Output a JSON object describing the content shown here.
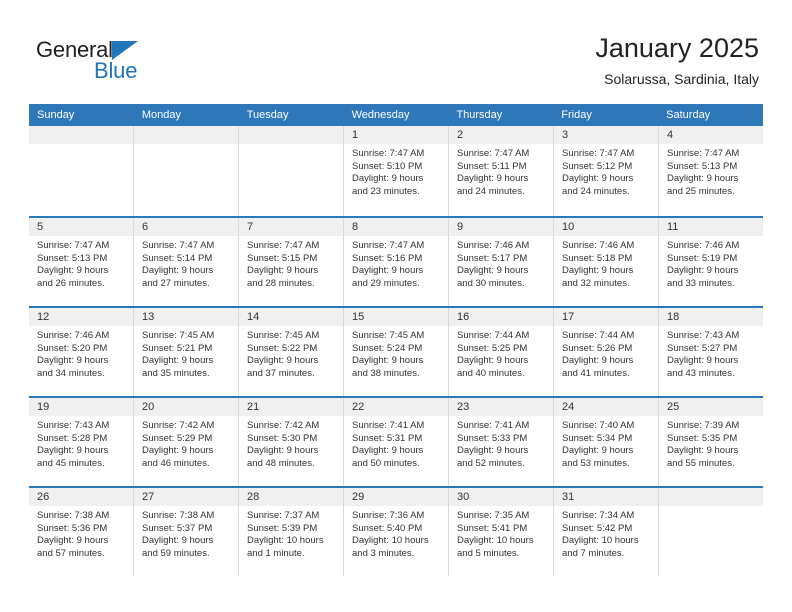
{
  "brand": {
    "name_dark": "General",
    "name_blue": "Blue",
    "accent_color": "#2e77b8"
  },
  "header": {
    "title": "January 2025",
    "subtitle": "Solarussa, Sardinia, Italy"
  },
  "calendar": {
    "day_headers": [
      "Sunday",
      "Monday",
      "Tuesday",
      "Wednesday",
      "Thursday",
      "Friday",
      "Saturday"
    ],
    "weeks": [
      [
        {
          "day": "",
          "lines": []
        },
        {
          "day": "",
          "lines": []
        },
        {
          "day": "",
          "lines": []
        },
        {
          "day": "1",
          "lines": [
            "Sunrise: 7:47 AM",
            "Sunset: 5:10 PM",
            "Daylight: 9 hours",
            "and 23 minutes."
          ]
        },
        {
          "day": "2",
          "lines": [
            "Sunrise: 7:47 AM",
            "Sunset: 5:11 PM",
            "Daylight: 9 hours",
            "and 24 minutes."
          ]
        },
        {
          "day": "3",
          "lines": [
            "Sunrise: 7:47 AM",
            "Sunset: 5:12 PM",
            "Daylight: 9 hours",
            "and 24 minutes."
          ]
        },
        {
          "day": "4",
          "lines": [
            "Sunrise: 7:47 AM",
            "Sunset: 5:13 PM",
            "Daylight: 9 hours",
            "and 25 minutes."
          ]
        }
      ],
      [
        {
          "day": "5",
          "lines": [
            "Sunrise: 7:47 AM",
            "Sunset: 5:13 PM",
            "Daylight: 9 hours",
            "and 26 minutes."
          ]
        },
        {
          "day": "6",
          "lines": [
            "Sunrise: 7:47 AM",
            "Sunset: 5:14 PM",
            "Daylight: 9 hours",
            "and 27 minutes."
          ]
        },
        {
          "day": "7",
          "lines": [
            "Sunrise: 7:47 AM",
            "Sunset: 5:15 PM",
            "Daylight: 9 hours",
            "and 28 minutes."
          ]
        },
        {
          "day": "8",
          "lines": [
            "Sunrise: 7:47 AM",
            "Sunset: 5:16 PM",
            "Daylight: 9 hours",
            "and 29 minutes."
          ]
        },
        {
          "day": "9",
          "lines": [
            "Sunrise: 7:46 AM",
            "Sunset: 5:17 PM",
            "Daylight: 9 hours",
            "and 30 minutes."
          ]
        },
        {
          "day": "10",
          "lines": [
            "Sunrise: 7:46 AM",
            "Sunset: 5:18 PM",
            "Daylight: 9 hours",
            "and 32 minutes."
          ]
        },
        {
          "day": "11",
          "lines": [
            "Sunrise: 7:46 AM",
            "Sunset: 5:19 PM",
            "Daylight: 9 hours",
            "and 33 minutes."
          ]
        }
      ],
      [
        {
          "day": "12",
          "lines": [
            "Sunrise: 7:46 AM",
            "Sunset: 5:20 PM",
            "Daylight: 9 hours",
            "and 34 minutes."
          ]
        },
        {
          "day": "13",
          "lines": [
            "Sunrise: 7:45 AM",
            "Sunset: 5:21 PM",
            "Daylight: 9 hours",
            "and 35 minutes."
          ]
        },
        {
          "day": "14",
          "lines": [
            "Sunrise: 7:45 AM",
            "Sunset: 5:22 PM",
            "Daylight: 9 hours",
            "and 37 minutes."
          ]
        },
        {
          "day": "15",
          "lines": [
            "Sunrise: 7:45 AM",
            "Sunset: 5:24 PM",
            "Daylight: 9 hours",
            "and 38 minutes."
          ]
        },
        {
          "day": "16",
          "lines": [
            "Sunrise: 7:44 AM",
            "Sunset: 5:25 PM",
            "Daylight: 9 hours",
            "and 40 minutes."
          ]
        },
        {
          "day": "17",
          "lines": [
            "Sunrise: 7:44 AM",
            "Sunset: 5:26 PM",
            "Daylight: 9 hours",
            "and 41 minutes."
          ]
        },
        {
          "day": "18",
          "lines": [
            "Sunrise: 7:43 AM",
            "Sunset: 5:27 PM",
            "Daylight: 9 hours",
            "and 43 minutes."
          ]
        }
      ],
      [
        {
          "day": "19",
          "lines": [
            "Sunrise: 7:43 AM",
            "Sunset: 5:28 PM",
            "Daylight: 9 hours",
            "and 45 minutes."
          ]
        },
        {
          "day": "20",
          "lines": [
            "Sunrise: 7:42 AM",
            "Sunset: 5:29 PM",
            "Daylight: 9 hours",
            "and 46 minutes."
          ]
        },
        {
          "day": "21",
          "lines": [
            "Sunrise: 7:42 AM",
            "Sunset: 5:30 PM",
            "Daylight: 9 hours",
            "and 48 minutes."
          ]
        },
        {
          "day": "22",
          "lines": [
            "Sunrise: 7:41 AM",
            "Sunset: 5:31 PM",
            "Daylight: 9 hours",
            "and 50 minutes."
          ]
        },
        {
          "day": "23",
          "lines": [
            "Sunrise: 7:41 AM",
            "Sunset: 5:33 PM",
            "Daylight: 9 hours",
            "and 52 minutes."
          ]
        },
        {
          "day": "24",
          "lines": [
            "Sunrise: 7:40 AM",
            "Sunset: 5:34 PM",
            "Daylight: 9 hours",
            "and 53 minutes."
          ]
        },
        {
          "day": "25",
          "lines": [
            "Sunrise: 7:39 AM",
            "Sunset: 5:35 PM",
            "Daylight: 9 hours",
            "and 55 minutes."
          ]
        }
      ],
      [
        {
          "day": "26",
          "lines": [
            "Sunrise: 7:38 AM",
            "Sunset: 5:36 PM",
            "Daylight: 9 hours",
            "and 57 minutes."
          ]
        },
        {
          "day": "27",
          "lines": [
            "Sunrise: 7:38 AM",
            "Sunset: 5:37 PM",
            "Daylight: 9 hours",
            "and 59 minutes."
          ]
        },
        {
          "day": "28",
          "lines": [
            "Sunrise: 7:37 AM",
            "Sunset: 5:39 PM",
            "Daylight: 10 hours",
            "and 1 minute."
          ]
        },
        {
          "day": "29",
          "lines": [
            "Sunrise: 7:36 AM",
            "Sunset: 5:40 PM",
            "Daylight: 10 hours",
            "and 3 minutes."
          ]
        },
        {
          "day": "30",
          "lines": [
            "Sunrise: 7:35 AM",
            "Sunset: 5:41 PM",
            "Daylight: 10 hours",
            "and 5 minutes."
          ]
        },
        {
          "day": "31",
          "lines": [
            "Sunrise: 7:34 AM",
            "Sunset: 5:42 PM",
            "Daylight: 10 hours",
            "and 7 minutes."
          ]
        },
        {
          "day": "",
          "lines": []
        }
      ]
    ]
  }
}
